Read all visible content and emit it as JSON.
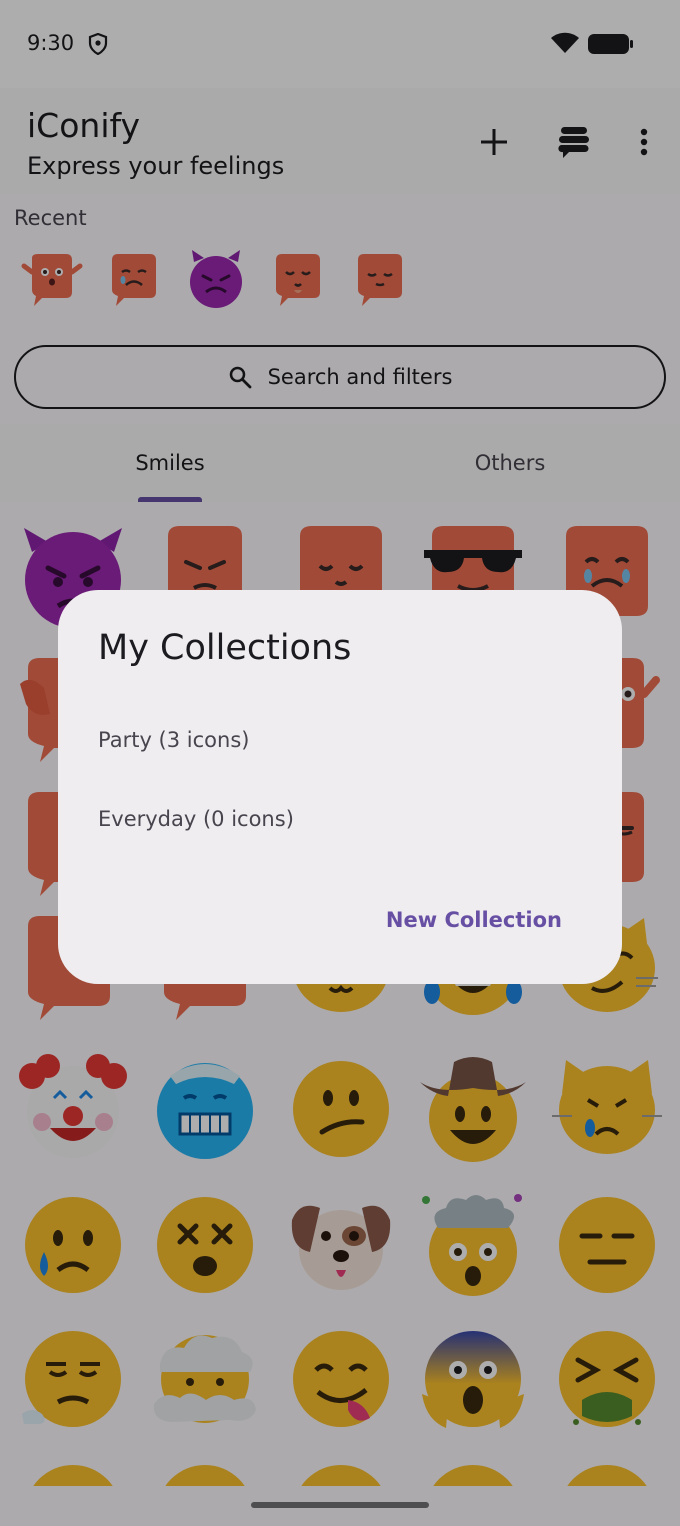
{
  "status_bar": {
    "time": "9:30"
  },
  "app_bar": {
    "title": "iConify",
    "subtitle": "Express your feelings"
  },
  "recent": {
    "label": "Recent",
    "items": [
      "blob-surprised-sticker",
      "blob-crying-sticker",
      "smiling-devil-emoji",
      "blob-pleading-sticker",
      "blob-relieved-sticker"
    ]
  },
  "search": {
    "label": "Search and filters"
  },
  "tabs": [
    {
      "label": "Smiles",
      "selected": true
    },
    {
      "label": "Others",
      "selected": false
    }
  ],
  "grid_rows": [
    [
      "angry-devil",
      "blob-angry",
      "blob-smirk",
      "blob-sunglasses",
      "blob-crying"
    ],
    [
      "blob-facepalm",
      "blob-hidden-1",
      "blob-hidden-2",
      "blob-hidden-3",
      "blob-waving"
    ],
    [
      "blob-side-1",
      "blob-hidden-4",
      "blob-hidden-5",
      "blob-hidden-6",
      "blob-unamused"
    ],
    [
      "blob-wave",
      "blob-sitting",
      "cat-smile",
      "grin-sweat",
      "cat-smirk"
    ],
    [
      "clown-face",
      "cold-face",
      "confused-face",
      "cowboy-face",
      "crying-cat"
    ],
    [
      "crying-face",
      "dizzy-face",
      "dog-face",
      "exploding-head",
      "expressionless-face"
    ],
    [
      "exhale-face",
      "face-in-clouds",
      "yum-face",
      "scream-face",
      "tired-face"
    ],
    [
      "row8-1",
      "row8-2",
      "row8-3",
      "row8-4",
      "row8-5"
    ]
  ],
  "dialog": {
    "title": "My Collections",
    "items": [
      "Party (3 icons)",
      "Everyday (0 icons)"
    ],
    "action_label": "New Collection"
  },
  "colors": {
    "accent": "#6750a4",
    "blob_orange": "#ee6e52",
    "emoji_yellow": "#fbc02d",
    "devil_purple": "#9c27b0",
    "scrim": "rgba(0,0,0,0.32)"
  }
}
